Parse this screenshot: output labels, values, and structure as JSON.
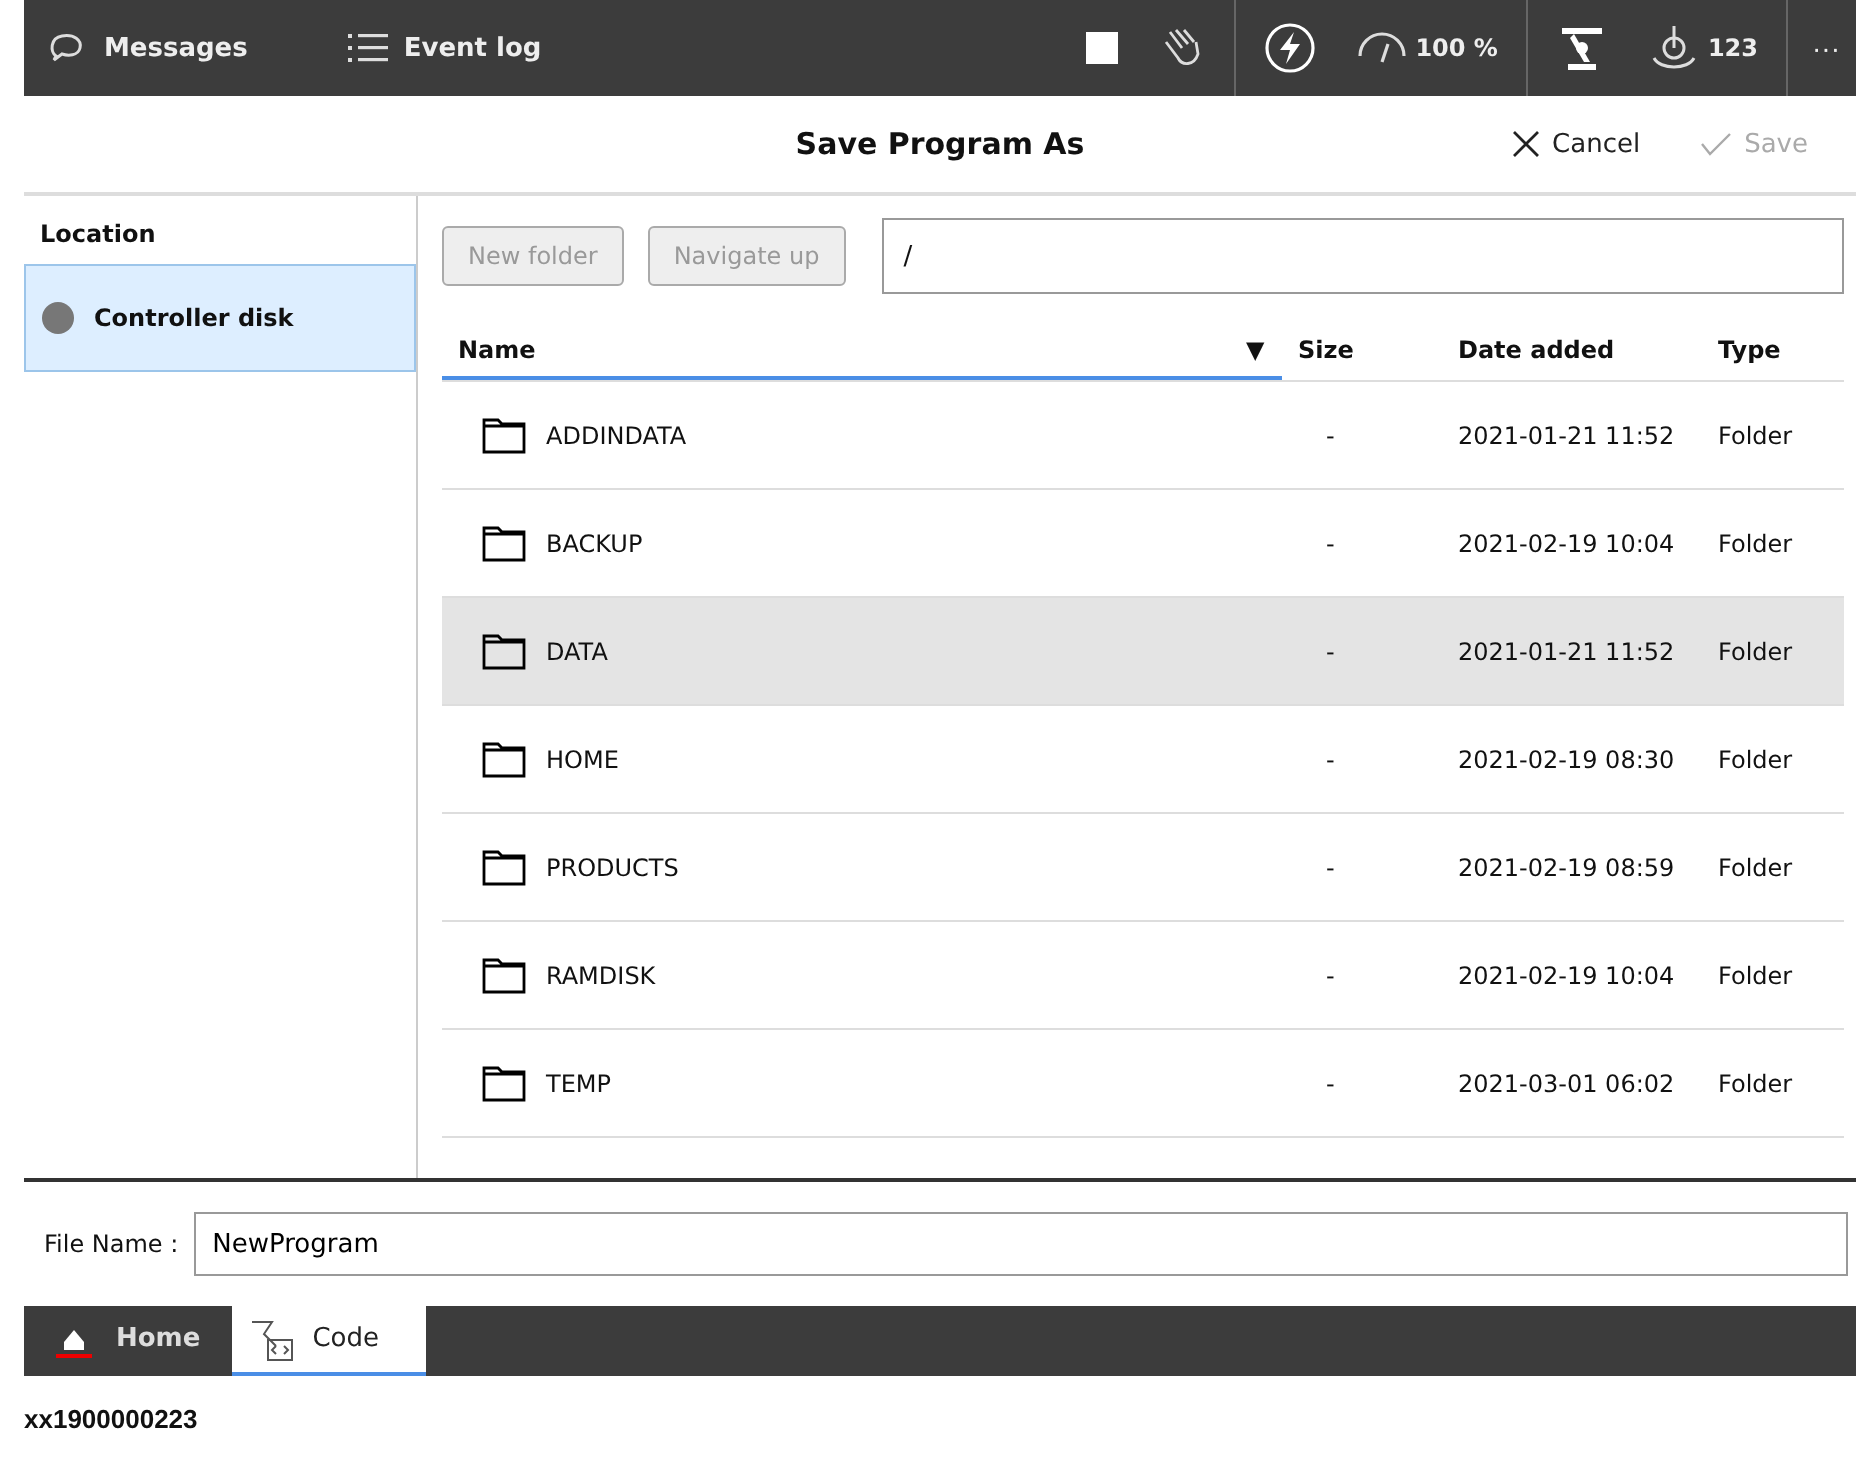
{
  "top_bar": {
    "left": [
      {
        "kind": "messages",
        "label": "Messages"
      },
      {
        "kind": "eventlog",
        "label": "Event log"
      }
    ],
    "speed": "100 %",
    "tool_number": "123",
    "more": "···"
  },
  "dialog": {
    "title": "Save Program As",
    "actions": [
      {
        "kind": "cancel",
        "label": "Cancel",
        "disabled": false
      },
      {
        "kind": "save",
        "label": "Save",
        "disabled": true
      }
    ]
  },
  "sidebar": {
    "heading": "Location",
    "items": [
      {
        "label": "Controller disk",
        "selected": true
      }
    ]
  },
  "toolbar": {
    "buttons": [
      {
        "label": "New folder",
        "disabled": true
      },
      {
        "label": "Navigate up",
        "disabled": true
      }
    ],
    "path": "/"
  },
  "table": {
    "columns": [
      {
        "label": "Name",
        "sorted": true
      },
      {
        "label": "Size",
        "sorted": false
      },
      {
        "label": "Date added",
        "sorted": false
      },
      {
        "label": "Type",
        "sorted": false
      }
    ],
    "sort_indicator": "▼",
    "rows": [
      {
        "name": "ADDINDATA",
        "size": "-",
        "date": "2021-01-21 11:52",
        "type": "Folder",
        "selected": false
      },
      {
        "name": "BACKUP",
        "size": "-",
        "date": "2021-02-19 10:04",
        "type": "Folder",
        "selected": false
      },
      {
        "name": "DATA",
        "size": "-",
        "date": "2021-01-21 11:52",
        "type": "Folder",
        "selected": true
      },
      {
        "name": "HOME",
        "size": "-",
        "date": "2021-02-19 08:30",
        "type": "Folder",
        "selected": false
      },
      {
        "name": "PRODUCTS",
        "size": "-",
        "date": "2021-02-19 08:59",
        "type": "Folder",
        "selected": false
      },
      {
        "name": "RAMDISK",
        "size": "-",
        "date": "2021-02-19 10:04",
        "type": "Folder",
        "selected": false
      },
      {
        "name": "TEMP",
        "size": "-",
        "date": "2021-03-01 06:02",
        "type": "Folder",
        "selected": false
      }
    ]
  },
  "file_name": {
    "label": "File Name :",
    "value": "NewProgram"
  },
  "taskbar": [
    {
      "kind": "home",
      "label": "Home",
      "selected": false
    },
    {
      "kind": "code",
      "label": "Code",
      "selected": true
    }
  ],
  "caption": "xx1900000223"
}
